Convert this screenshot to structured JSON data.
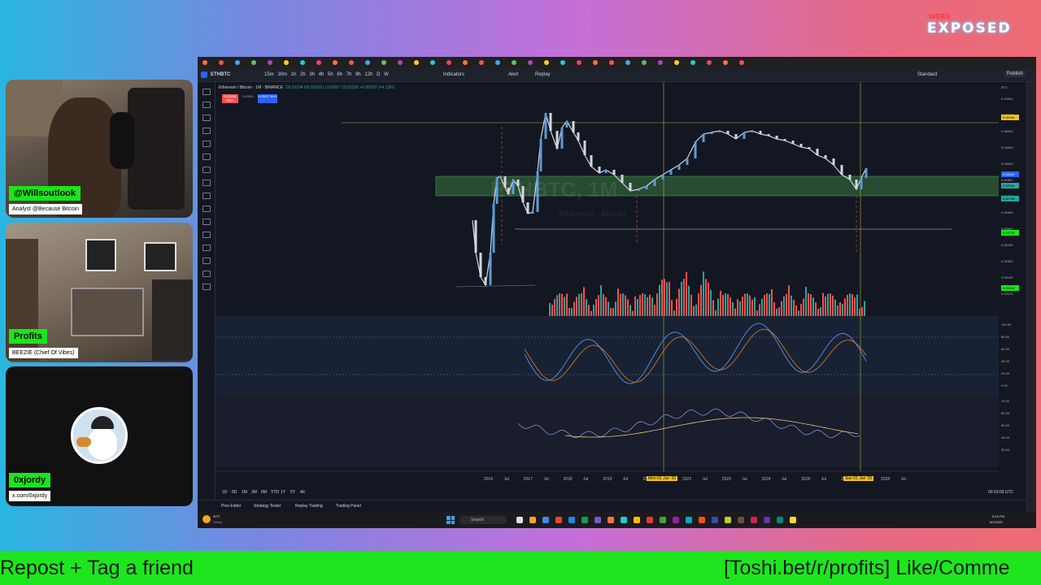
{
  "logo": {
    "small": "WEB3",
    "big": "EXPOSED"
  },
  "cams": [
    {
      "name": "@Willsoutlook",
      "sub": "Analyst @Because Bitcoin"
    },
    {
      "name": "Profits",
      "sub": "BEEZIE (Chief Of Vibes)"
    },
    {
      "name": "0xjordy",
      "sub": "x.com/0xjordy"
    }
  ],
  "toolbar": {
    "symbol": "ETHBTC",
    "intervals": [
      "15m",
      "30m",
      "1h",
      "2h",
      "3h",
      "4h",
      "5h",
      "6h",
      "7h",
      "8h",
      "12h",
      "D",
      "W"
    ],
    "indicators": "Indicators",
    "alert": "Alert",
    "replay": "Replay",
    "layout": "Standard",
    "publish": "Publish"
  },
  "legend": {
    "title": "Ethereum / Bitcoin · 1M · BINANCE",
    "ohlc": "O0.03194  H0.03338  L0.02997  C0.03226  +0.00032 (+4.13%)",
    "sell": "0.03226 SELL",
    "mid": "0.00001",
    "buy": "0.03227 BUY"
  },
  "watermark": {
    "main": "ETHBTC, 1M",
    "sub": "Ethereum · Bitcoin"
  },
  "pricescale": {
    "currency": "BTC",
    "labels": [
      "0.15000",
      "0.10000",
      "0.06000",
      "0.04000",
      "0.03000",
      "0.01800",
      "0.01300",
      "0.00900",
      "0.00600",
      "0.00430",
      "0.00300",
      "0.00190",
      "0.00123"
    ],
    "tags": [
      "0.09154",
      "0.03226",
      "0.02914",
      "0.01748",
      "0.00776",
      "0.00218"
    ],
    "rsi": [
      "100.00",
      "80.00",
      "60.00",
      "40.00",
      "20.00",
      "0.00"
    ],
    "osc": [
      "70.00",
      "60.00",
      "50.00",
      "40.00",
      "30.00"
    ]
  },
  "timeaxis": {
    "labels": [
      "2016",
      "Jul",
      "2017",
      "Jul",
      "2018",
      "Jul",
      "2019",
      "Jul",
      "2021",
      "Jul",
      "2022",
      "Jul",
      "2023",
      "Jul",
      "2024",
      "Jul",
      "2026",
      "Jul",
      "2027",
      "Jul",
      "2028",
      "Jul"
    ],
    "highlight1": "Mon 01 Jun '20",
    "highlight2": "Sun 01 Jun '25"
  },
  "range": [
    "1D",
    "5D",
    "1M",
    "3M",
    "6M",
    "YTD",
    "1Y",
    "5Y",
    "All"
  ],
  "clock": "00:19:03 UTC",
  "bottompanel": [
    "Pine Editor",
    "Strategy Tester",
    "Replay Trading",
    "Trading Panel"
  ],
  "taskbar": {
    "search": "Search",
    "weather": "83°F",
    "weather_sub": "Sunny",
    "time": "5:18 PM",
    "date": "8/1/2025"
  },
  "banner": {
    "left": "Repost + Tag a friend",
    "right": "[Toshi.bet/r/profits] Like/Comme"
  },
  "colors": {
    "green_bar": "#1ee61e",
    "tv_bg": "#131722",
    "up": "#26a69a",
    "down": "#ef5350"
  }
}
